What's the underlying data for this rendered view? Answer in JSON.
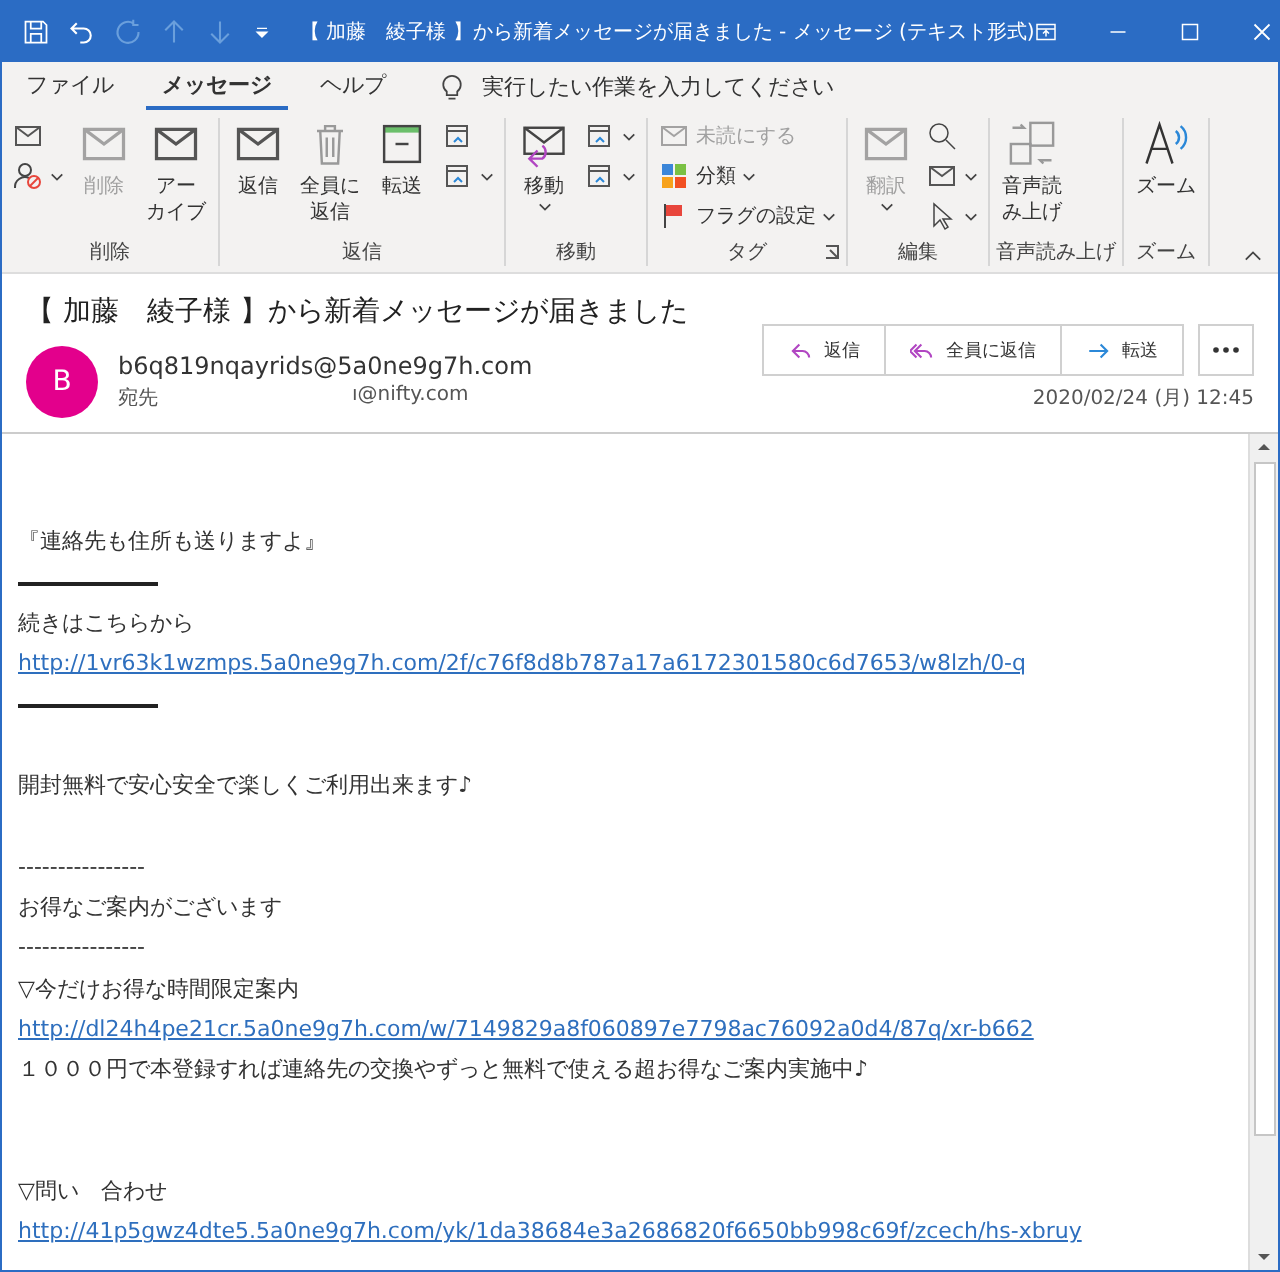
{
  "window": {
    "title": "【 加藤　綾子様 】から新着メッセージが届きました  -  メッセージ (テキスト形式)"
  },
  "tabs": [
    {
      "label": "ファイル",
      "selected": false
    },
    {
      "label": "メッセージ",
      "selected": true
    },
    {
      "label": "ヘルプ",
      "selected": false
    }
  ],
  "tell_me": {
    "placeholder": "実行したい作業を入力してください"
  },
  "ribbon": {
    "groups": [
      {
        "label": "削除",
        "items": [
          {
            "kind": "stack",
            "items": [
              {
                "dropdown": false
              },
              {
                "dropdown": true
              }
            ]
          },
          {
            "kind": "large",
            "lines": [
              "削除"
            ],
            "disabled": true,
            "dropdown": false
          },
          {
            "kind": "large",
            "lines": [
              "アー",
              "カイブ"
            ],
            "disabled": false,
            "dropdown": false
          }
        ]
      },
      {
        "label": "返信",
        "items": [
          {
            "kind": "large",
            "lines": [
              "返信"
            ],
            "disabled": false,
            "dropdown": false
          },
          {
            "kind": "large",
            "lines": [
              "全員に",
              "返信"
            ],
            "disabled": false,
            "dropdown": false
          },
          {
            "kind": "large",
            "lines": [
              "転送"
            ],
            "disabled": false,
            "dropdown": false
          },
          {
            "kind": "stack",
            "items": [
              {
                "dropdown": false
              },
              {
                "dropdown": true
              }
            ]
          }
        ]
      },
      {
        "label": "移動",
        "items": [
          {
            "kind": "large",
            "lines": [
              "移動"
            ],
            "disabled": false,
            "dropdown": true
          },
          {
            "kind": "stack",
            "items": [
              {
                "dropdown": true
              },
              {
                "dropdown": true
              }
            ]
          }
        ]
      },
      {
        "label": "タグ",
        "launcher": true,
        "items": [
          {
            "kind": "stack",
            "items": [
              {
                "label": "未読にする",
                "disabled": true,
                "dropdown": false
              },
              {
                "label": "分類",
                "disabled": false,
                "dropdown": true
              },
              {
                "label": "フラグの設定",
                "disabled": false,
                "dropdown": true
              }
            ]
          }
        ]
      },
      {
        "label": "編集",
        "items": [
          {
            "kind": "large",
            "lines": [
              "翻訳"
            ],
            "disabled": true,
            "dropdown": true
          },
          {
            "kind": "stack",
            "items": [
              {
                "dropdown": false
              },
              {
                "dropdown": true
              },
              {
                "dropdown": true
              }
            ]
          }
        ]
      },
      {
        "label": "音声読み上げ",
        "items": [
          {
            "kind": "large",
            "lines": [
              "音声読",
              "み上げ"
            ],
            "disabled": false,
            "dropdown": false
          }
        ]
      },
      {
        "label": "ズーム",
        "items": [
          {
            "kind": "large",
            "lines": [
              "ズーム"
            ],
            "disabled": false,
            "dropdown": false
          }
        ]
      }
    ]
  },
  "message": {
    "subject": "【 加藤　綾子様 】から新着メッセージが届きました",
    "avatar": {
      "letter": "B",
      "color": "#e3008c"
    },
    "sender": "b6q819nqayrids@5a0ne9g7h.com",
    "to_label": "宛先",
    "to": "ı@nifty.com",
    "date": "2020/02/24 (月) 12:45",
    "actions": [
      "返信",
      "全員に返信",
      "転送"
    ]
  },
  "body": [
    {
      "kind": "blank"
    },
    {
      "kind": "text",
      "text": "『連絡先も住所も送りますよ』"
    },
    {
      "kind": "rule"
    },
    {
      "kind": "text",
      "text": "続きはこちらから"
    },
    {
      "kind": "link",
      "text": "http://1vr63k1wzmps.5a0ne9g7h.com/2f/c76f8d8b787a17a6172301580c6d7653/w8lzh/0-q"
    },
    {
      "kind": "rule"
    },
    {
      "kind": "blank"
    },
    {
      "kind": "text",
      "text": "開封無料で安心安全で楽しくご利用出来ます♪"
    },
    {
      "kind": "blank"
    },
    {
      "kind": "text",
      "text": "----------------"
    },
    {
      "kind": "text",
      "text": "お得なご案内がございます"
    },
    {
      "kind": "text",
      "text": "----------------"
    },
    {
      "kind": "text",
      "text": "▽今だけお得な時間限定案内"
    },
    {
      "kind": "link",
      "text": "http://dl24h4pe21cr.5a0ne9g7h.com/w/7149829a8f060897e7798ac76092a0d4/87q/xr-b662"
    },
    {
      "kind": "text",
      "text": "１０００円で本登録すれば連絡先の交換やずっと無料で使える超お得なご案内実施中♪"
    },
    {
      "kind": "blank"
    },
    {
      "kind": "blank"
    },
    {
      "kind": "text",
      "text": "▽問い　合わせ"
    },
    {
      "kind": "link",
      "text": "http://41p5gwz4dte5.5a0ne9g7h.com/yk/1da38684e3a2686820f6650bb998c69f/zcech/hs-xbruy"
    }
  ]
}
